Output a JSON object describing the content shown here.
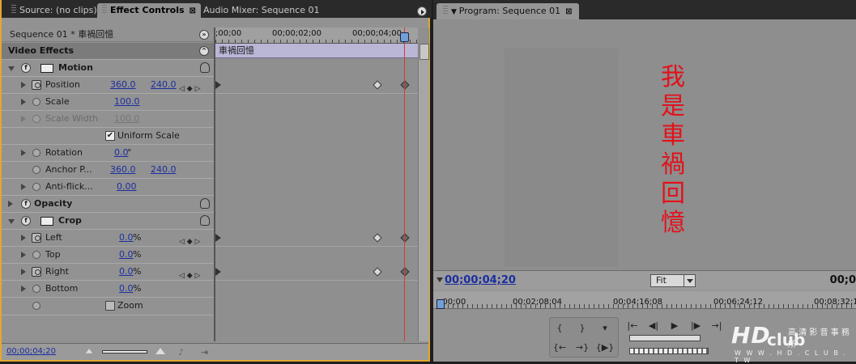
{
  "tabs": [
    {
      "label": "Source: (no clips)"
    },
    {
      "label": "Effect Controls",
      "close": "⊠"
    },
    {
      "label": "Audio Mixer: Sequence 01"
    }
  ],
  "effect_controls": {
    "sequence_label": "Sequence 01 * 車禍回憶",
    "video_effects_label": "Video Effects",
    "rows": {
      "motion": "Motion",
      "position": {
        "label": "Position",
        "x": "360.0",
        "y": "240.0"
      },
      "scale": {
        "label": "Scale",
        "value": "100.0"
      },
      "scale_width": {
        "label": "Scale Width",
        "value": "100.0"
      },
      "uniform_scale": {
        "label": "Uniform Scale",
        "checked": "✔"
      },
      "rotation": {
        "label": "Rotation",
        "value": "0.0",
        "unit": "°"
      },
      "anchor": {
        "label": "Anchor P...",
        "x": "360.0",
        "y": "240.0"
      },
      "antiflicker": {
        "label": "Anti-flick...",
        "value": "0.00"
      },
      "opacity": "Opacity",
      "crop": "Crop",
      "left": {
        "label": "Left",
        "value": "0.0",
        "unit": "%"
      },
      "top": {
        "label": "Top",
        "value": "0.0",
        "unit": "%"
      },
      "right": {
        "label": "Right",
        "value": "0.0",
        "unit": "%"
      },
      "bottom": {
        "label": "Bottom",
        "value": "0.0",
        "unit": "%"
      },
      "zoom": {
        "label": "Zoom"
      }
    },
    "ruler": {
      "t0": ";00;00",
      "t1": "00;00;02;00",
      "t2": "00;00;04;00"
    },
    "clip_name": "車禍回憶",
    "timecode": "00;00;04;20"
  },
  "program": {
    "tab_label": "Program: Sequence 01",
    "overlay_text": [
      "我",
      "是",
      "車",
      "禍",
      "回",
      "憶"
    ],
    "timecode": "00;00;04;20",
    "fit_label": "Fit",
    "duration": "00;0",
    "ruler": {
      "t0": ";00;00",
      "t1": "00;02;08;04",
      "t2": "00;04;16;08",
      "t3": "00;06;24;12",
      "t4": "00;08;32;1"
    }
  },
  "watermark": {
    "logo": "HD",
    "club": "club",
    "sub": "高 清 影 音 事 務 所",
    "url": "W W W . H D . C L U B . T W"
  },
  "colors": {
    "accent": "#e3a82e",
    "timecode": "#1b2ea0",
    "overlay_text": "#e3111a",
    "playhead": "#d43b3b",
    "clip": "#b9b6d6"
  }
}
